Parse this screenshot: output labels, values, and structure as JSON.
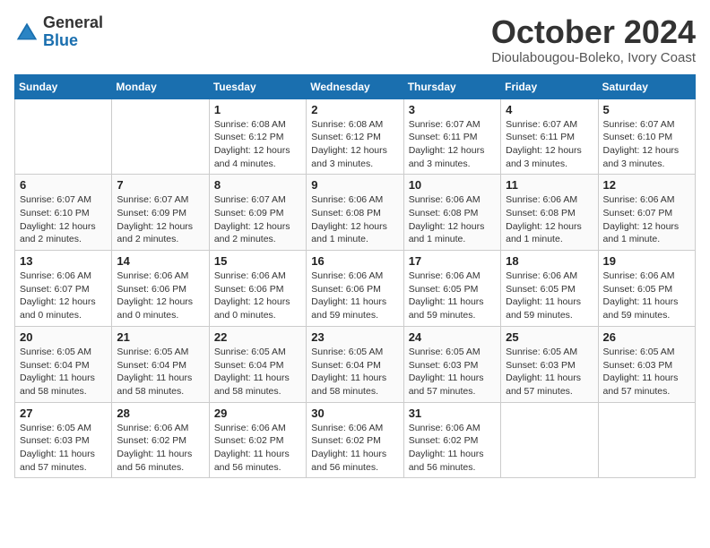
{
  "header": {
    "logo_general": "General",
    "logo_blue": "Blue",
    "month_title": "October 2024",
    "location": "Dioulabougou-Boleko, Ivory Coast"
  },
  "days_of_week": [
    "Sunday",
    "Monday",
    "Tuesday",
    "Wednesday",
    "Thursday",
    "Friday",
    "Saturday"
  ],
  "weeks": [
    [
      {
        "day": "",
        "info": ""
      },
      {
        "day": "",
        "info": ""
      },
      {
        "day": "1",
        "info": "Sunrise: 6:08 AM\nSunset: 6:12 PM\nDaylight: 12 hours and 4 minutes."
      },
      {
        "day": "2",
        "info": "Sunrise: 6:08 AM\nSunset: 6:12 PM\nDaylight: 12 hours and 3 minutes."
      },
      {
        "day": "3",
        "info": "Sunrise: 6:07 AM\nSunset: 6:11 PM\nDaylight: 12 hours and 3 minutes."
      },
      {
        "day": "4",
        "info": "Sunrise: 6:07 AM\nSunset: 6:11 PM\nDaylight: 12 hours and 3 minutes."
      },
      {
        "day": "5",
        "info": "Sunrise: 6:07 AM\nSunset: 6:10 PM\nDaylight: 12 hours and 3 minutes."
      }
    ],
    [
      {
        "day": "6",
        "info": "Sunrise: 6:07 AM\nSunset: 6:10 PM\nDaylight: 12 hours and 2 minutes."
      },
      {
        "day": "7",
        "info": "Sunrise: 6:07 AM\nSunset: 6:09 PM\nDaylight: 12 hours and 2 minutes."
      },
      {
        "day": "8",
        "info": "Sunrise: 6:07 AM\nSunset: 6:09 PM\nDaylight: 12 hours and 2 minutes."
      },
      {
        "day": "9",
        "info": "Sunrise: 6:06 AM\nSunset: 6:08 PM\nDaylight: 12 hours and 1 minute."
      },
      {
        "day": "10",
        "info": "Sunrise: 6:06 AM\nSunset: 6:08 PM\nDaylight: 12 hours and 1 minute."
      },
      {
        "day": "11",
        "info": "Sunrise: 6:06 AM\nSunset: 6:08 PM\nDaylight: 12 hours and 1 minute."
      },
      {
        "day": "12",
        "info": "Sunrise: 6:06 AM\nSunset: 6:07 PM\nDaylight: 12 hours and 1 minute."
      }
    ],
    [
      {
        "day": "13",
        "info": "Sunrise: 6:06 AM\nSunset: 6:07 PM\nDaylight: 12 hours and 0 minutes."
      },
      {
        "day": "14",
        "info": "Sunrise: 6:06 AM\nSunset: 6:06 PM\nDaylight: 12 hours and 0 minutes."
      },
      {
        "day": "15",
        "info": "Sunrise: 6:06 AM\nSunset: 6:06 PM\nDaylight: 12 hours and 0 minutes."
      },
      {
        "day": "16",
        "info": "Sunrise: 6:06 AM\nSunset: 6:06 PM\nDaylight: 11 hours and 59 minutes."
      },
      {
        "day": "17",
        "info": "Sunrise: 6:06 AM\nSunset: 6:05 PM\nDaylight: 11 hours and 59 minutes."
      },
      {
        "day": "18",
        "info": "Sunrise: 6:06 AM\nSunset: 6:05 PM\nDaylight: 11 hours and 59 minutes."
      },
      {
        "day": "19",
        "info": "Sunrise: 6:06 AM\nSunset: 6:05 PM\nDaylight: 11 hours and 59 minutes."
      }
    ],
    [
      {
        "day": "20",
        "info": "Sunrise: 6:05 AM\nSunset: 6:04 PM\nDaylight: 11 hours and 58 minutes."
      },
      {
        "day": "21",
        "info": "Sunrise: 6:05 AM\nSunset: 6:04 PM\nDaylight: 11 hours and 58 minutes."
      },
      {
        "day": "22",
        "info": "Sunrise: 6:05 AM\nSunset: 6:04 PM\nDaylight: 11 hours and 58 minutes."
      },
      {
        "day": "23",
        "info": "Sunrise: 6:05 AM\nSunset: 6:04 PM\nDaylight: 11 hours and 58 minutes."
      },
      {
        "day": "24",
        "info": "Sunrise: 6:05 AM\nSunset: 6:03 PM\nDaylight: 11 hours and 57 minutes."
      },
      {
        "day": "25",
        "info": "Sunrise: 6:05 AM\nSunset: 6:03 PM\nDaylight: 11 hours and 57 minutes."
      },
      {
        "day": "26",
        "info": "Sunrise: 6:05 AM\nSunset: 6:03 PM\nDaylight: 11 hours and 57 minutes."
      }
    ],
    [
      {
        "day": "27",
        "info": "Sunrise: 6:05 AM\nSunset: 6:03 PM\nDaylight: 11 hours and 57 minutes."
      },
      {
        "day": "28",
        "info": "Sunrise: 6:06 AM\nSunset: 6:02 PM\nDaylight: 11 hours and 56 minutes."
      },
      {
        "day": "29",
        "info": "Sunrise: 6:06 AM\nSunset: 6:02 PM\nDaylight: 11 hours and 56 minutes."
      },
      {
        "day": "30",
        "info": "Sunrise: 6:06 AM\nSunset: 6:02 PM\nDaylight: 11 hours and 56 minutes."
      },
      {
        "day": "31",
        "info": "Sunrise: 6:06 AM\nSunset: 6:02 PM\nDaylight: 11 hours and 56 minutes."
      },
      {
        "day": "",
        "info": ""
      },
      {
        "day": "",
        "info": ""
      }
    ]
  ]
}
